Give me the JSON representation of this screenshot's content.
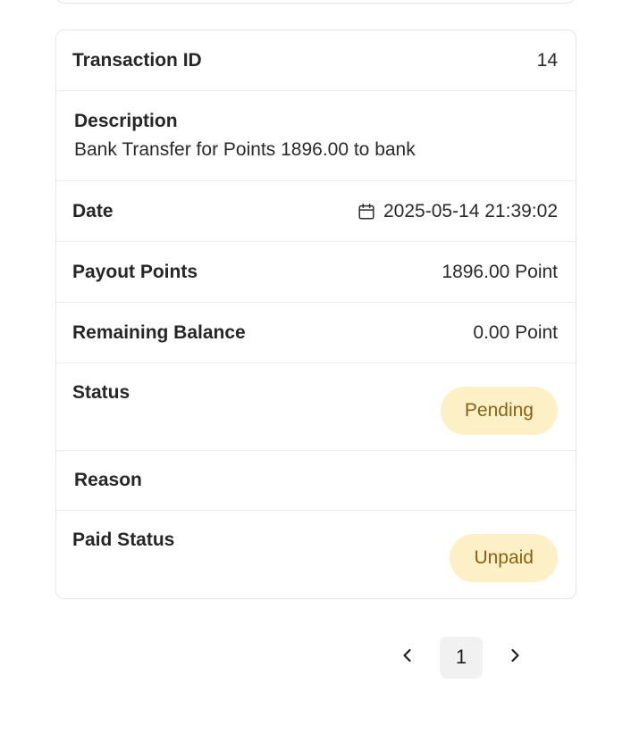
{
  "transaction": {
    "id_label": "Transaction ID",
    "id_value": "14",
    "description_label": "Description",
    "description_value": "Bank Transfer for Points 1896.00 to bank",
    "date_label": "Date",
    "date_value": "2025-05-14 21:39:02",
    "payout_label": "Payout Points",
    "payout_value": "1896.00 Point",
    "balance_label": "Remaining Balance",
    "balance_value": "0.00 Point",
    "status_label": "Status",
    "status_value": "Pending",
    "reason_label": "Reason",
    "paid_status_label": "Paid Status",
    "paid_status_value": "Unpaid"
  },
  "icons": {
    "date": "calendar-icon",
    "prev": "chevron-left-icon",
    "next": "chevron-right-icon"
  },
  "pagination": {
    "current_page": "1"
  },
  "colors": {
    "badge_bg": "#fdf0c6",
    "badge_text": "#8a6312",
    "current_page_bg": "#f1f1f1"
  }
}
